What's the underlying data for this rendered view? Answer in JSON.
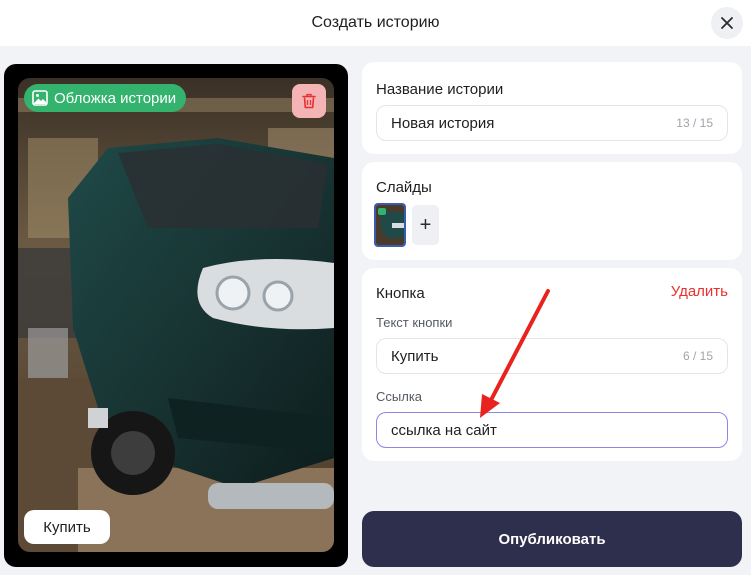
{
  "header": {
    "title": "Создать историю"
  },
  "preview": {
    "cover_badge": "Обложка истории",
    "button_label": "Купить"
  },
  "title_card": {
    "label": "Название истории",
    "value": "Новая история",
    "counter": "13 / 15"
  },
  "slides_card": {
    "label": "Слайды",
    "add_label": "+"
  },
  "button_card": {
    "label": "Кнопка",
    "delete_label": "Удалить",
    "text_label": "Текст кнопки",
    "text_value": "Купить",
    "text_counter": "6 / 15",
    "link_label": "Ссылка",
    "link_value": "ссылка на сайт"
  },
  "actions": {
    "publish_label": "Опубликовать"
  },
  "colors": {
    "accent_green": "#33b36d",
    "danger": "#e8312f",
    "publish_bg": "#2e2e4d",
    "active_border": "#8e86e6",
    "arrow": "#e8231d"
  },
  "icons": [
    "close-icon",
    "image-icon",
    "trash-icon",
    "plus-icon"
  ]
}
